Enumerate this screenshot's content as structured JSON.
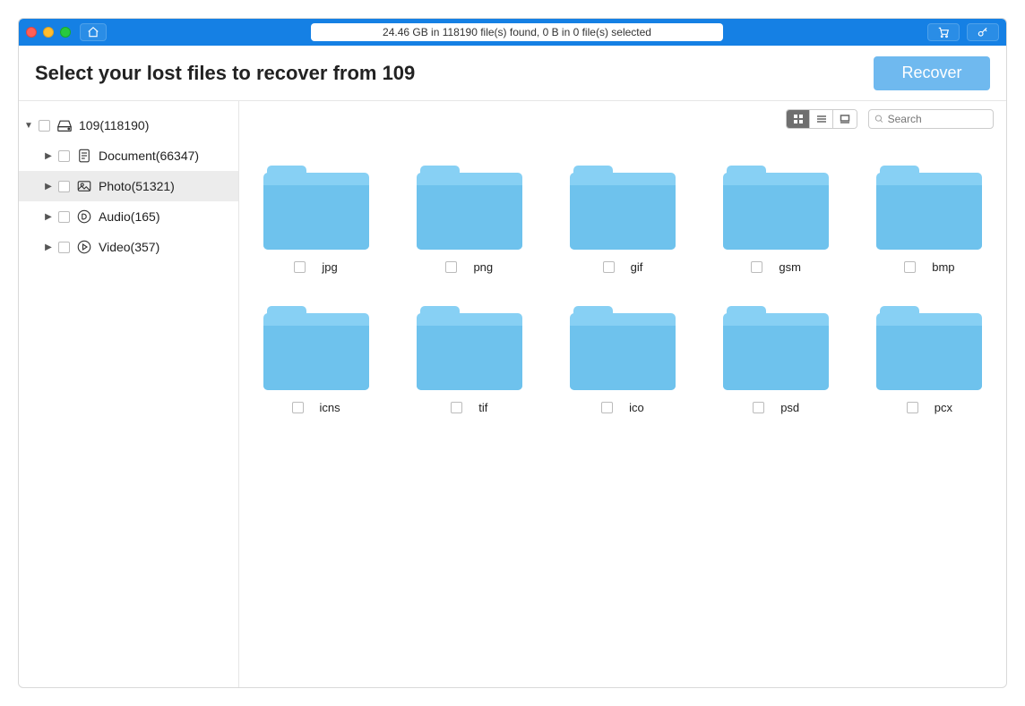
{
  "status_text": "24.46 GB in 118190 file(s) found, 0 B in 0 file(s) selected",
  "header": {
    "title": "Select your lost files to recover from 109",
    "recover_label": "Recover"
  },
  "sidebar": {
    "root": {
      "label": "109(118190)"
    },
    "items": [
      {
        "label": "Document(66347)"
      },
      {
        "label": "Photo(51321)"
      },
      {
        "label": "Audio(165)"
      },
      {
        "label": "Video(357)"
      }
    ]
  },
  "search": {
    "placeholder": "Search"
  },
  "folders": [
    {
      "name": "jpg"
    },
    {
      "name": "png"
    },
    {
      "name": "gif"
    },
    {
      "name": "gsm"
    },
    {
      "name": "bmp"
    },
    {
      "name": "icns"
    },
    {
      "name": "tif"
    },
    {
      "name": "ico"
    },
    {
      "name": "psd"
    },
    {
      "name": "pcx"
    }
  ]
}
